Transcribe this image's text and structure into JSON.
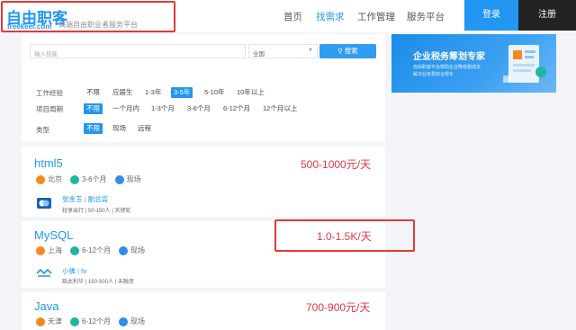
{
  "header": {
    "logo_cn": "自由职客",
    "logo_en": "freekeer.com",
    "slogan": "高端自由职业者服务平台",
    "nav": [
      "首页",
      "找需求",
      "工作管理",
      "服务平台"
    ],
    "login": "登录",
    "register": "注册"
  },
  "search": {
    "placeholder": "输入技能",
    "city": "全国",
    "button": "搜索"
  },
  "filters": {
    "experience_label": "工作经验",
    "experience": [
      "不限",
      "应届生",
      "1-3年",
      "3-5年",
      "5-10年",
      "10年以上"
    ],
    "period_label": "项目周期",
    "period": [
      "不限",
      "一个月内",
      "1-3个月",
      "3-6个月",
      "6-12个月",
      "12个月以上"
    ],
    "type_label": "类型",
    "type": [
      "不限",
      "现场",
      "远程"
    ]
  },
  "jobs": [
    {
      "title": "html5",
      "salary": "500-1000元/天",
      "city": "北京",
      "period": "3-6个月",
      "mode": "现场",
      "contact": "张金玉",
      "role": "副总监",
      "company": "轻享出行",
      "size": "50-150人",
      "stage": "天使轮"
    },
    {
      "title": "MySQL",
      "salary": "1.0-1.5K/天",
      "city": "上海",
      "period": "6-12个月",
      "mode": "现场",
      "contact": "小佛",
      "role": "hr",
      "company": "蹈太利华",
      "size": "150-500人",
      "stage": "未融资"
    },
    {
      "title": "Java",
      "salary": "700-900元/天",
      "city": "天津",
      "period": "6-12个月",
      "mode": "现场"
    }
  ],
  "ad": {
    "title": "企业税务筹划专家",
    "line1": "自由职客平台帮助企业降低税成本",
    "line2": "解决业务费获合规化"
  },
  "colors": {
    "accent": "#2196f3",
    "salary": "#e8334a",
    "highlight_box": "#e53935"
  }
}
